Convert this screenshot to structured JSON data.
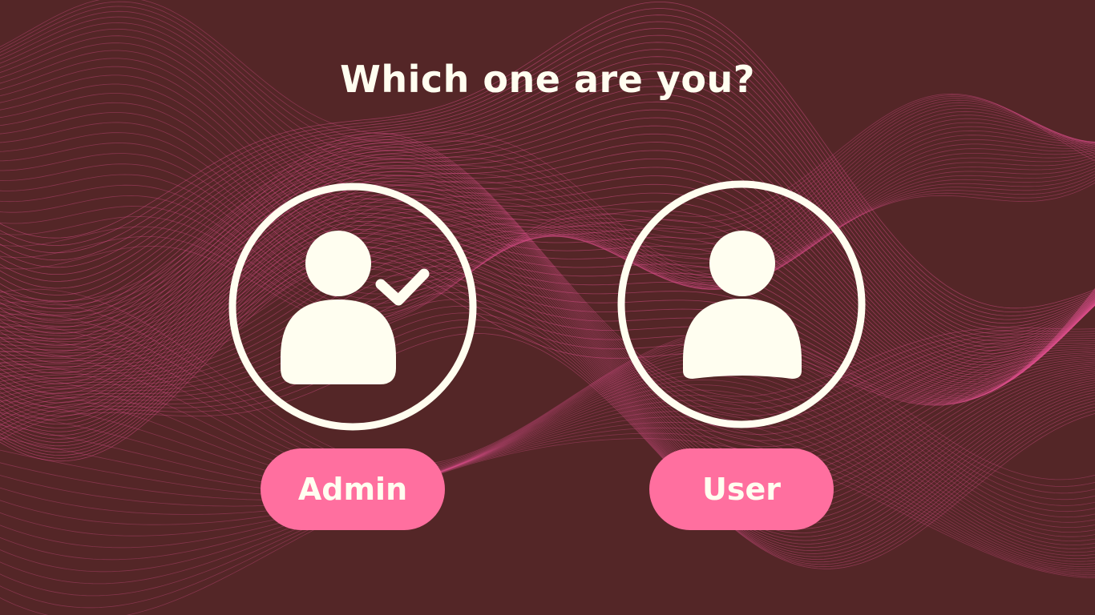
{
  "colors": {
    "background": "#542627",
    "wave": "#E0508E",
    "foreground": "#FFFEF0",
    "button": "#FF6F9F"
  },
  "heading": "Which one are you?",
  "roles": [
    {
      "label": "Admin",
      "icon": "user-check-icon"
    },
    {
      "label": "User",
      "icon": "user-icon"
    }
  ]
}
